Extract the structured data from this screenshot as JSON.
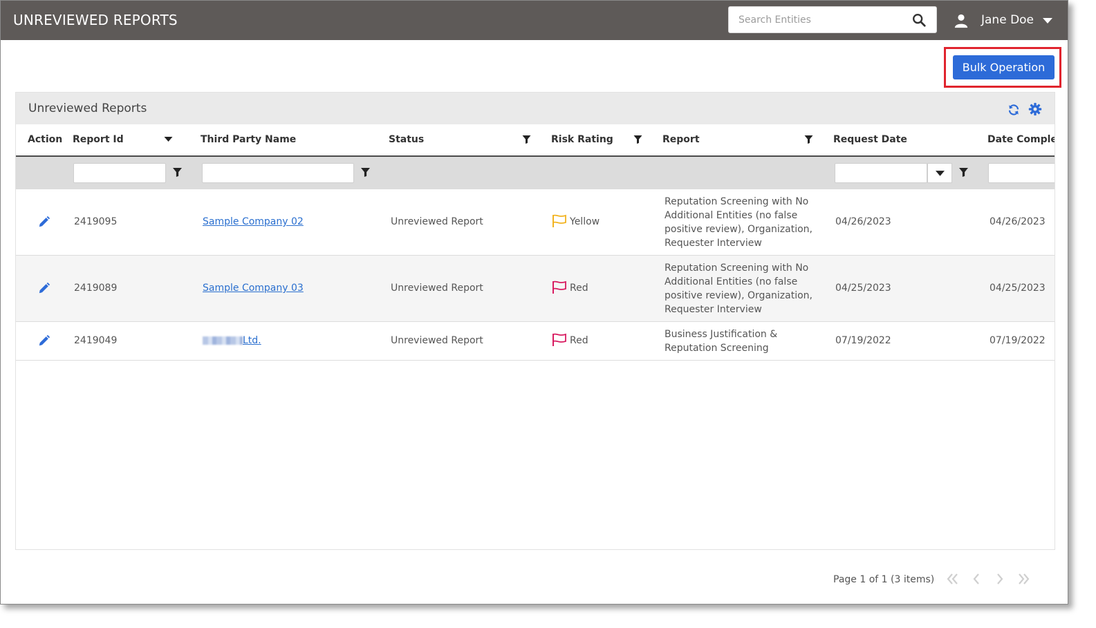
{
  "header": {
    "title": "UNREVIEWED REPORTS",
    "search_placeholder": "Search Entities",
    "user_name": "Jane Doe"
  },
  "toolbar": {
    "bulk_label": "Bulk Operation"
  },
  "panel": {
    "title": "Unreviewed Reports"
  },
  "columns": [
    "Action",
    "Report Id",
    "Third Party Name",
    "Status",
    "Risk Rating",
    "Report",
    "Request Date",
    "Date Complet"
  ],
  "rows": [
    {
      "report_id": "2419095",
      "third_party": "Sample Company 02",
      "status": "Unreviewed Report",
      "risk": "Yellow",
      "risk_color": "#f2b320",
      "report": "Reputation Screening with No Additional Entities (no false positive review), Organization, Requester Interview",
      "request_date": "04/26/2023",
      "date_completed": "04/26/2023"
    },
    {
      "report_id": "2419089",
      "third_party": "Sample Company 03",
      "status": "Unreviewed Report",
      "risk": "Red",
      "risk_color": "#d81b60",
      "report": "Reputation Screening with No Additional Entities (no false positive review), Organization, Requester Interview",
      "request_date": "04/25/2023",
      "date_completed": "04/25/2023"
    },
    {
      "report_id": "2419049",
      "third_party": "Ltd.",
      "status": "Unreviewed Report",
      "risk": "Red",
      "risk_color": "#d81b60",
      "report": "Business Justification & Reputation Screening",
      "request_date": "07/19/2022",
      "date_completed": "07/19/2022"
    }
  ],
  "pager": {
    "text": "Page 1 of 1 (3 items)"
  },
  "colors": {
    "topbar": "#5e5a58",
    "accent": "#2d6bd8",
    "highlight": "#e0242e",
    "link": "#2a6fcf"
  }
}
